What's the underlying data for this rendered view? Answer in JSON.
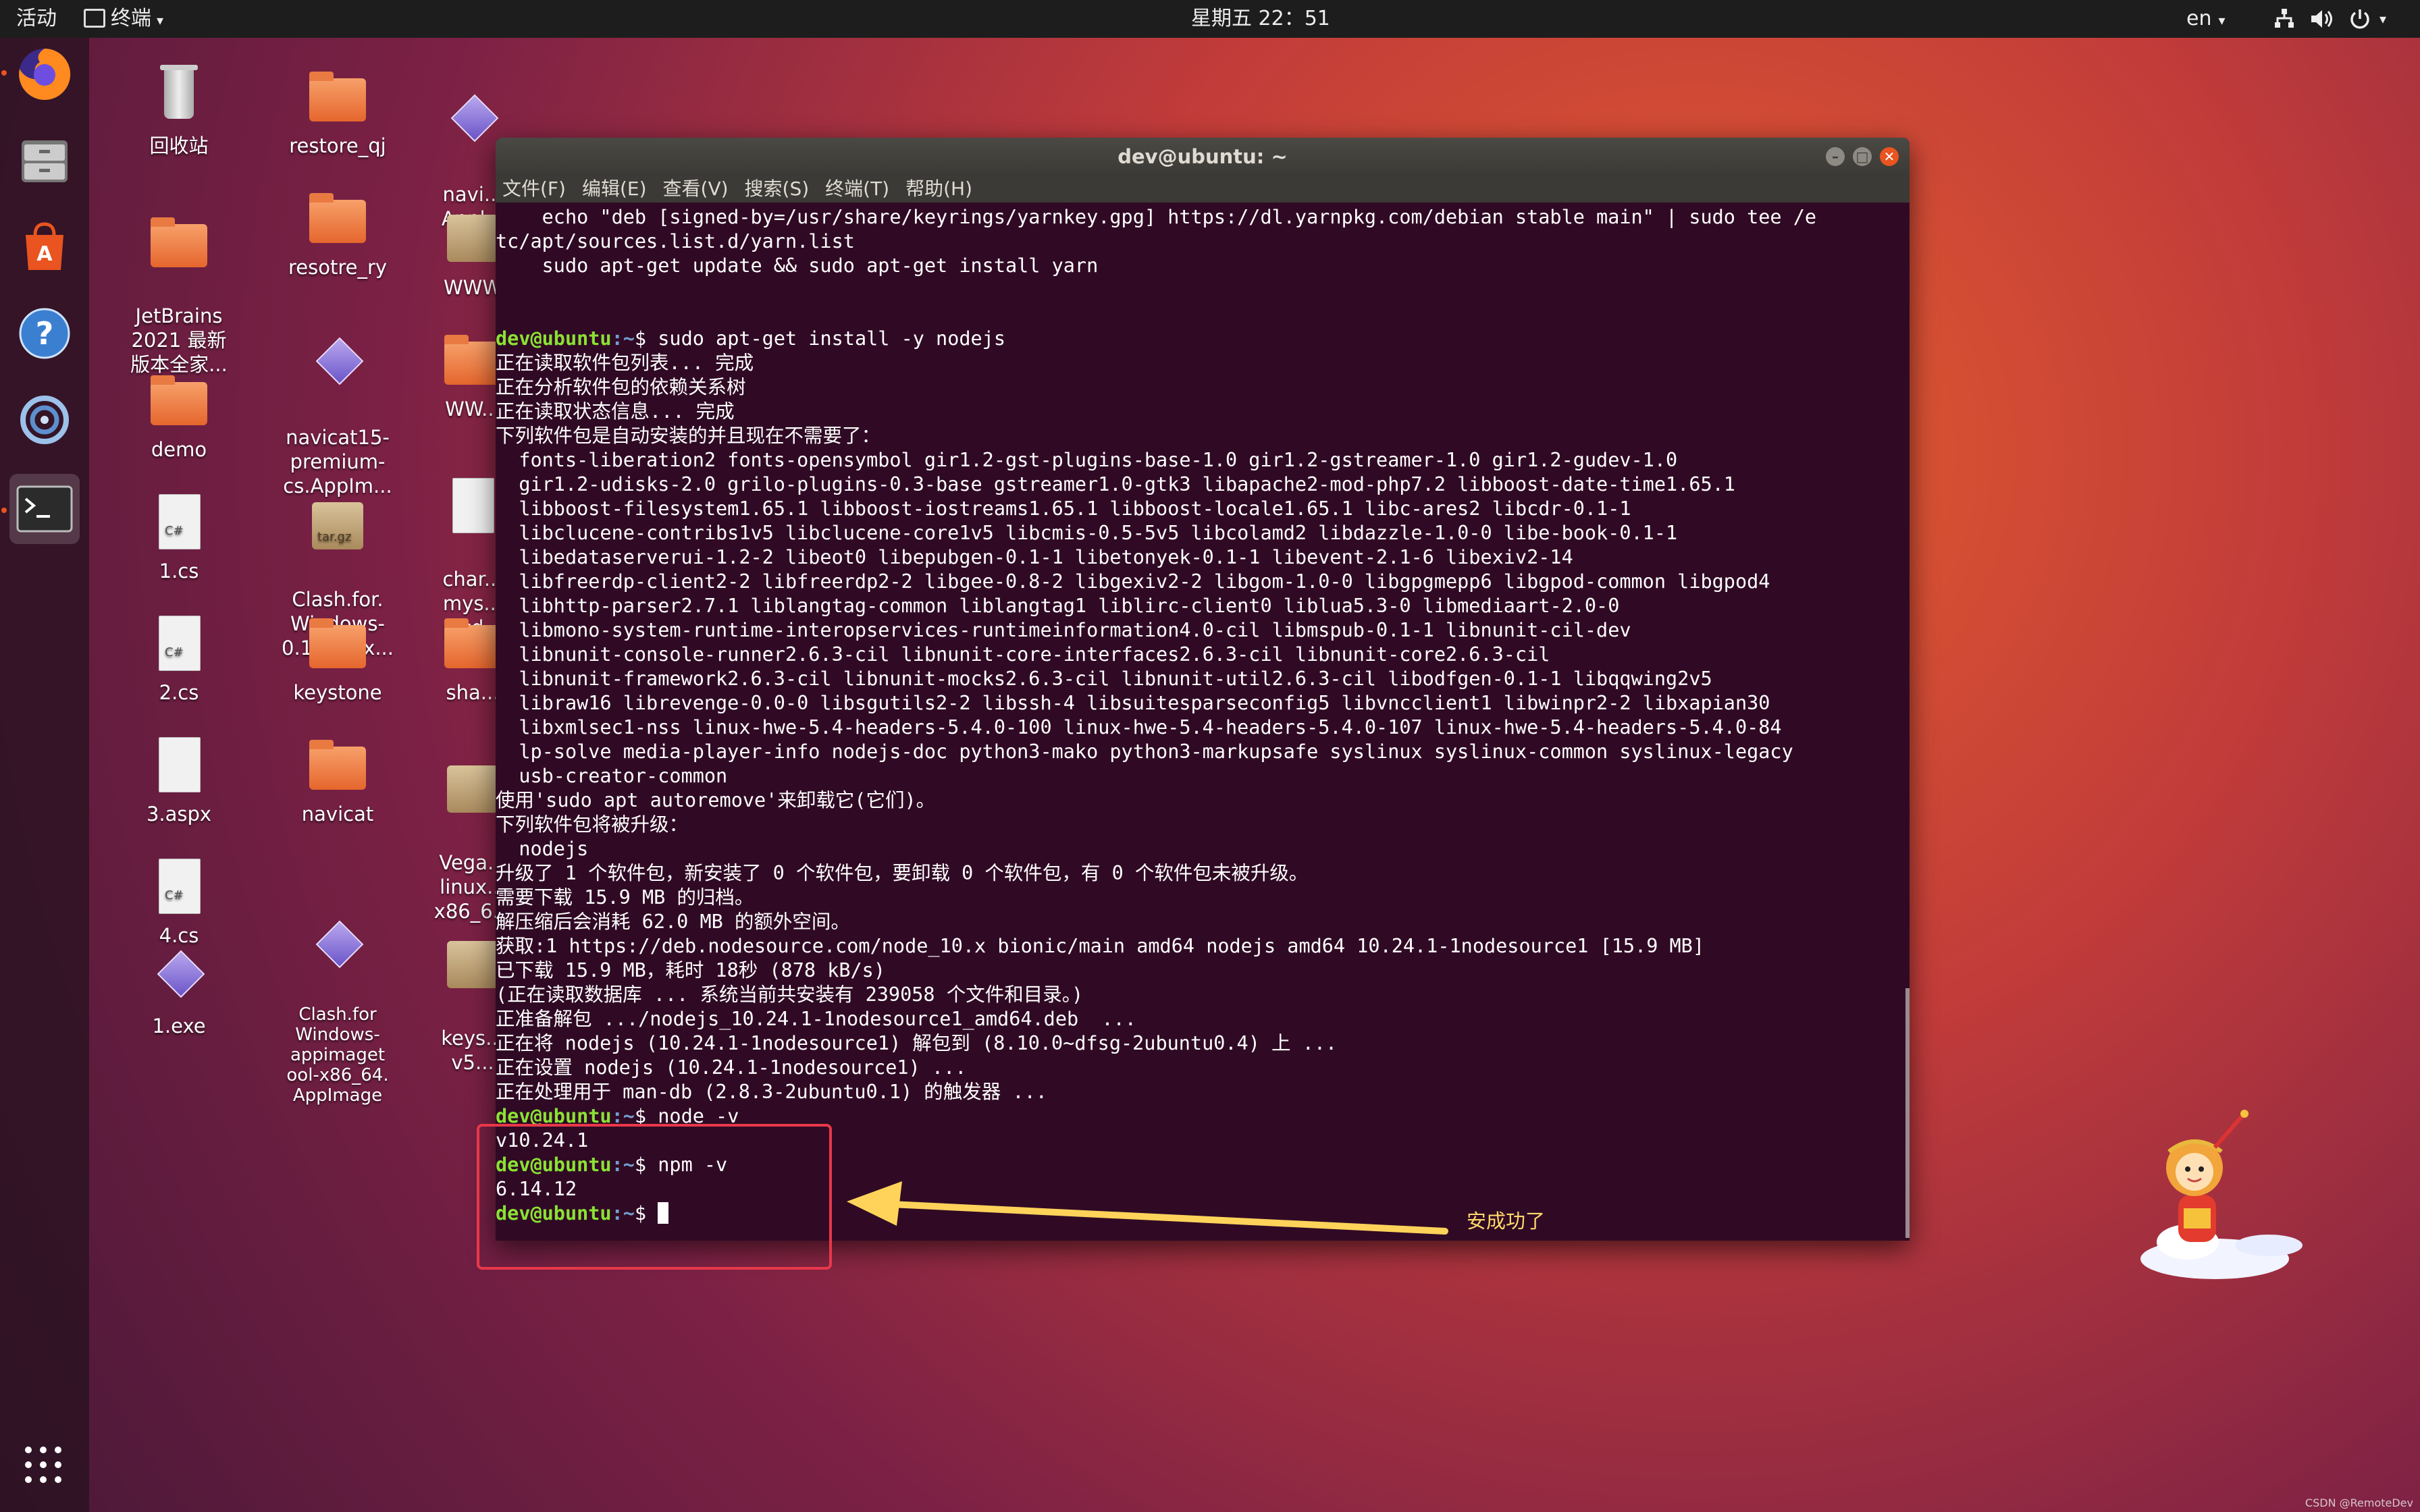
{
  "topbar": {
    "activities": "活动",
    "app_menu": "终端",
    "clock": "星期五 22：51",
    "language": "en"
  },
  "dock": {
    "items": [
      "firefox",
      "files",
      "software-center",
      "help",
      "remote-desktop",
      "terminal"
    ]
  },
  "desktop": {
    "icons": [
      {
        "label": "回收站",
        "type": "trash"
      },
      {
        "label": "restore_qj",
        "type": "folder"
      },
      {
        "label": "navi...\nAppl...",
        "type": "appimage"
      },
      {
        "label": "JetBrains\n2021 最新\n版本全家...",
        "type": "folder"
      },
      {
        "label": "resotre_ry",
        "type": "folder"
      },
      {
        "label": "WWW",
        "type": "archive"
      },
      {
        "label": "navicat15-\npremium-\ncs.AppIm...",
        "type": "appimage"
      },
      {
        "label": "WW...",
        "type": "folder"
      },
      {
        "label": "demo",
        "type": "folder"
      },
      {
        "label": "1.cs",
        "type": "cs"
      },
      {
        "label": "Clash.for.\nWindows-\n0.19.15-x...",
        "type": "archive"
      },
      {
        "label": "char...\nmys...\npwd...",
        "type": "doc"
      },
      {
        "label": "2.cs",
        "type": "cs"
      },
      {
        "label": "keystone",
        "type": "folder"
      },
      {
        "label": "sha...",
        "type": "folder"
      },
      {
        "label": "3.aspx",
        "type": "doc"
      },
      {
        "label": "navicat",
        "type": "folder"
      },
      {
        "label": "Vega...\nlinux...\nx86_6...",
        "type": "archive"
      },
      {
        "label": "4.cs",
        "type": "cs"
      },
      {
        "label": "Clash.for\nWindows-\nappimaget\nool-x86_64.\nAppImage",
        "type": "appimage"
      },
      {
        "label": "keys...\nv5...",
        "type": "archive"
      },
      {
        "label": "1.exe",
        "type": "appimage"
      }
    ]
  },
  "terminal": {
    "title": "dev@ubuntu: ~",
    "menu": [
      "文件(F)",
      "编辑(E)",
      "查看(V)",
      "搜索(S)",
      "终端(T)",
      "帮助(H)"
    ],
    "lines": [
      "    echo \"deb [signed-by=/usr/share/keyrings/yarnkey.gpg] https://dl.yarnpkg.com/debian stable main\" | sudo tee /e",
      "tc/apt/sources.list.d/yarn.list",
      "    sudo apt-get update && sudo apt-get install yarn",
      "",
      "",
      "{P}sudo apt-get install -y nodejs",
      "正在读取软件包列表... 完成",
      "正在分析软件包的依赖关系树",
      "正在读取状态信息... 完成",
      "下列软件包是自动安装的并且现在不需要了：",
      "  fonts-liberation2 fonts-opensymbol gir1.2-gst-plugins-base-1.0 gir1.2-gstreamer-1.0 gir1.2-gudev-1.0",
      "  gir1.2-udisks-2.0 grilo-plugins-0.3-base gstreamer1.0-gtk3 libapache2-mod-php7.2 libboost-date-time1.65.1",
      "  libboost-filesystem1.65.1 libboost-iostreams1.65.1 libboost-locale1.65.1 libc-ares2 libcdr-0.1-1",
      "  libclucene-contribs1v5 libclucene-core1v5 libcmis-0.5-5v5 libcolamd2 libdazzle-1.0-0 libe-book-0.1-1",
      "  libedataserverui-1.2-2 libeot0 libepubgen-0.1-1 libetonyek-0.1-1 libevent-2.1-6 libexiv2-14",
      "  libfreerdp-client2-2 libfreerdp2-2 libgee-0.8-2 libgexiv2-2 libgom-1.0-0 libgpgmepp6 libgpod-common libgpod4",
      "  libhttp-parser2.7.1 liblangtag-common liblangtag1 liblirc-client0 liblua5.3-0 libmediaart-2.0-0",
      "  libmono-system-runtime-interopservices-runtimeinformation4.0-cil libmspub-0.1-1 libnunit-cil-dev",
      "  libnunit-console-runner2.6.3-cil libnunit-core-interfaces2.6.3-cil libnunit-core2.6.3-cil",
      "  libnunit-framework2.6.3-cil libnunit-mocks2.6.3-cil libnunit-util2.6.3-cil libodfgen-0.1-1 libqqwing2v5",
      "  libraw16 librevenge-0.0-0 libsgutils2-2 libssh-4 libsuitesparseconfig5 libvncclient1 libwinpr2-2 libxapian30",
      "  libxmlsec1-nss linux-hwe-5.4-headers-5.4.0-100 linux-hwe-5.4-headers-5.4.0-107 linux-hwe-5.4-headers-5.4.0-84",
      "  lp-solve media-player-info nodejs-doc python3-mako python3-markupsafe syslinux syslinux-common syslinux-legacy",
      "  usb-creator-common",
      "使用'sudo apt autoremove'来卸载它(它们)。",
      "下列软件包将被升级：",
      "  nodejs",
      "升级了 1 个软件包，新安装了 0 个软件包，要卸载 0 个软件包，有 0 个软件包未被升级。",
      "需要下载 15.9 MB 的归档。",
      "解压缩后会消耗 62.0 MB 的额外空间。",
      "获取:1 https://deb.nodesource.com/node_10.x bionic/main amd64 nodejs amd64 10.24.1-1nodesource1 [15.9 MB]",
      "已下载 15.9 MB，耗时 18秒 (878 kB/s)",
      "(正在读取数据库 ... 系统当前共安装有 239058 个文件和目录。)",
      "正准备解包 .../nodejs_10.24.1-1nodesource1_amd64.deb  ...",
      "正在将 nodejs (10.24.1-1nodesource1) 解包到 (8.10.0~dfsg-2ubuntu0.4) 上 ...",
      "正在设置 nodejs (10.24.1-1nodesource1) ...",
      "正在处理用于 man-db (2.8.3-2ubuntu0.1) 的触发器 ...",
      "{P}node -v",
      "v10.24.1",
      "{P}npm -v",
      "6.14.12",
      "{C}"
    ],
    "prompt_user": "dev@ubuntu",
    "prompt_path": ":~",
    "prompt_symbol": "$ "
  },
  "annotation": {
    "text": "安成功了",
    "box_color": "#e8384a",
    "arrow_color": "#ffd35a"
  },
  "watermark": "CSDN @RemoteDev",
  "colors": {
    "terminal_bg": "#300a24",
    "prompt_user": "#8ae234",
    "prompt_path": "#729fcf",
    "ubuntu_orange": "#e95420"
  }
}
